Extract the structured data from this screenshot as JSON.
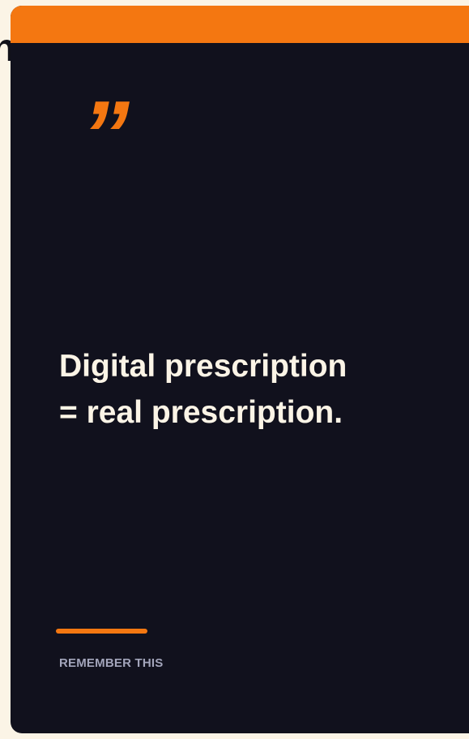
{
  "background_fragment": "n",
  "card": {
    "quote_glyph": "”",
    "quote_text": "Digital prescription\n= real prescription.",
    "caption": "REMEMBER THIS"
  },
  "colors": {
    "accent": "#f47711",
    "card_background": "#11111d",
    "page_background": "#fbf4e6",
    "quote_text": "#fbf4e6",
    "caption": "#a3a5bb"
  }
}
